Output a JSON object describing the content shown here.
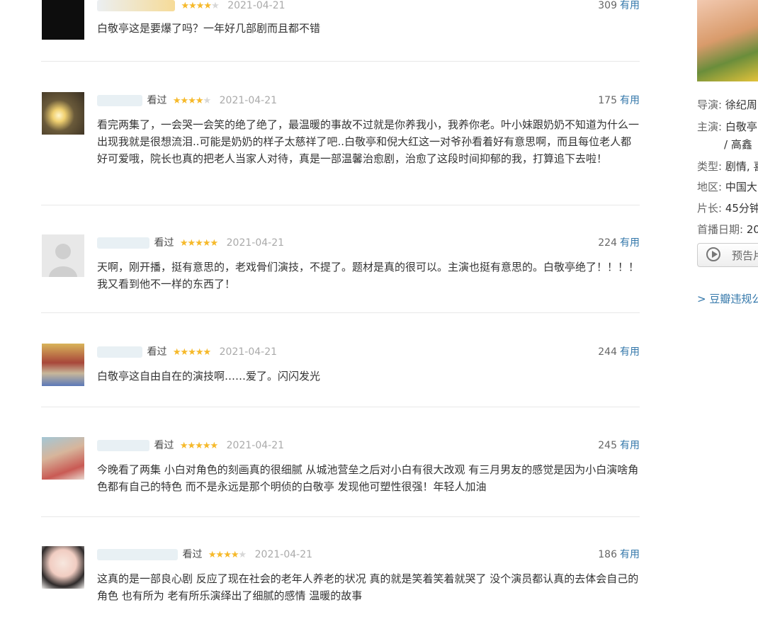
{
  "comments": [
    {
      "status": "",
      "rating": 4,
      "date": "2021-04-21",
      "votes": "309",
      "useful": "有用",
      "text": "白敬亭这是要爆了吗？一年好几部剧而且都不错"
    },
    {
      "status": "看过",
      "rating": 4,
      "date": "2021-04-21",
      "votes": "175",
      "useful": "有用",
      "text": "看完两集了，一会哭一会笑的绝了绝了，最温暖的事故不过就是你养我小，我养你老。叶小妹跟奶奶不知道为什么一出现我就是很想流泪..可能是奶奶的样子太慈祥了吧..白敬亭和倪大红这一对爷孙看着好有意思啊，而且每位老人都好可爱哦，院长也真的把老人当家人对待，真是一部温馨治愈剧，治愈了这段时间抑郁的我，打算追下去啦！"
    },
    {
      "status": "看过",
      "rating": 5,
      "date": "2021-04-21",
      "votes": "224",
      "useful": "有用",
      "text": "天啊，刚开播，挺有意思的，老戏骨们演技，不提了。题材是真的很可以。主演也挺有意思的。白敬亭绝了！！！！我又看到他不一样的东西了！"
    },
    {
      "status": "看过",
      "rating": 5,
      "date": "2021-04-21",
      "votes": "244",
      "useful": "有用",
      "text": "白敬亭这自由自在的演技啊……爱了。闪闪发光"
    },
    {
      "status": "看过",
      "rating": 5,
      "date": "2021-04-21",
      "votes": "245",
      "useful": "有用",
      "text": "今晚看了两集 小白对角色的刻画真的很细腻 从城池营垒之后对小白有很大改观 有三月男友的感觉是因为小白演啥角色都有自己的特色 而不是永远是那个明侦的白敬亭 发现他可塑性很强！年轻人加油"
    },
    {
      "status": "看过",
      "rating": 4,
      "date": "2021-04-21",
      "votes": "186",
      "useful": "有用",
      "text": "这真的是一部良心剧 反应了现在社会的老年人养老的状况 真的就是笑着笑着就哭了 没个演员都认真的去体会自己的角色 也有所为 老有所乐演绎出了细腻的感情 温暖的故事"
    }
  ],
  "side": {
    "director_label": "导演:",
    "director": "徐纪周",
    "cast_label": "主演:",
    "cast": "白敬亭",
    "cast_more": "/ 高鑫",
    "genre_label": "类型:",
    "genre": "剧情, 喜",
    "region_label": "地区:",
    "region": "中国大",
    "runtime_label": "片长:",
    "runtime": "45分钟",
    "premiere_label": "首播日期:",
    "premiere": "20",
    "trailer_label": "预告片",
    "report_link": "> 豆瓣违规公"
  }
}
